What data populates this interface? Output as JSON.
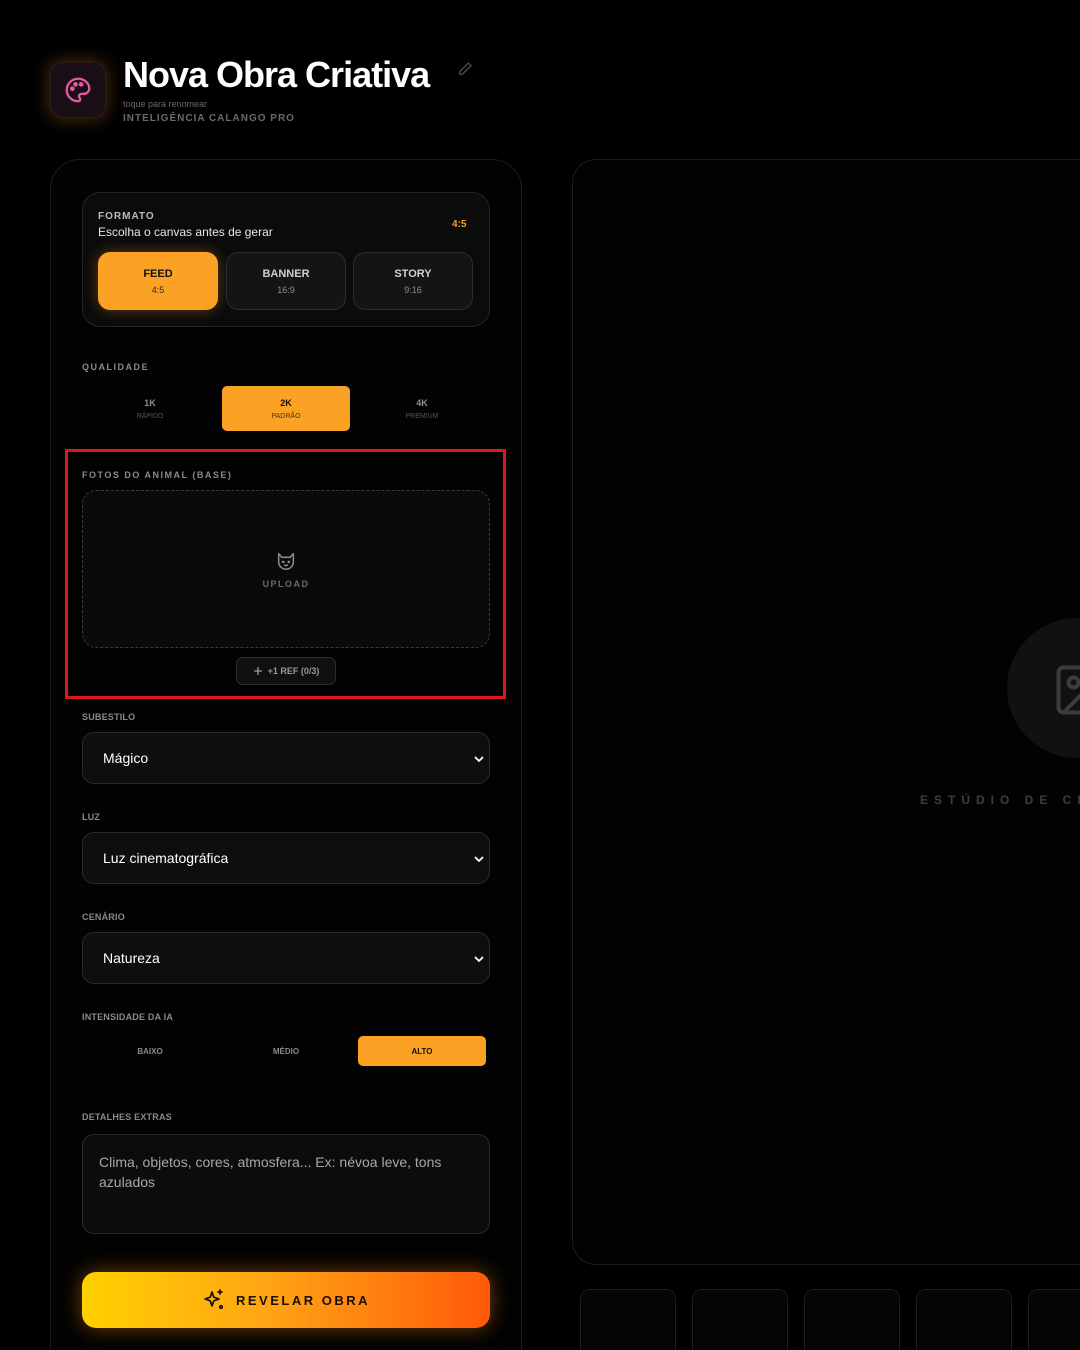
{
  "header": {
    "title": "Nova Obra Criativa",
    "rename_hint": "toque para renomear",
    "brand": "INTELIGÊNCIA CALANGO PRO"
  },
  "format": {
    "label": "FORMATO",
    "description": "Escolha o canvas antes de gerar",
    "current_ratio": "4:5",
    "options": [
      {
        "label": "FEED",
        "ratio": "4:5",
        "active": true
      },
      {
        "label": "BANNER",
        "ratio": "16:9",
        "active": false
      },
      {
        "label": "STORY",
        "ratio": "9:16",
        "active": false
      }
    ]
  },
  "quality": {
    "label": "QUALIDADE",
    "options": [
      {
        "label": "1K",
        "sub": "RÁPIDO",
        "active": false
      },
      {
        "label": "2K",
        "sub": "PADRÃO",
        "active": true
      },
      {
        "label": "4K",
        "sub": "PREMIUM",
        "active": false
      }
    ]
  },
  "photos": {
    "label": "FOTOS DO ANIMAL (BASE)",
    "upload_label": "UPLOAD",
    "add_ref_label": "+1 REF (0/3)"
  },
  "substyle": {
    "label": "SUBESTILO",
    "value": "Mágico"
  },
  "light": {
    "label": "LUZ",
    "value": "Luz cinematográfica"
  },
  "scenery": {
    "label": "CENÁRIO",
    "value": "Natureza"
  },
  "intensity": {
    "label": "INTENSIDADE DA IA",
    "options": [
      {
        "label": "BAIXO",
        "active": false
      },
      {
        "label": "MÉDIO",
        "active": false
      },
      {
        "label": "ALTO",
        "active": true
      }
    ]
  },
  "details": {
    "label": "DETALHES EXTRAS",
    "placeholder": "Clima, objetos, cores, atmosfera... Ex: névoa leve, tons azulados"
  },
  "reveal_button": {
    "label": "REVELAR OBRA"
  },
  "studio": {
    "placeholder_text": "ESTÚDIO DE CR"
  },
  "colors": {
    "accent": "#fba124",
    "highlight_border": "#e01717",
    "app_icon": "#e85aa0"
  },
  "icons": [
    "palette-icon",
    "pencil-icon",
    "cat-icon",
    "plus-icon",
    "chevron-down-icon",
    "sparkles-icon",
    "image-icon"
  ]
}
